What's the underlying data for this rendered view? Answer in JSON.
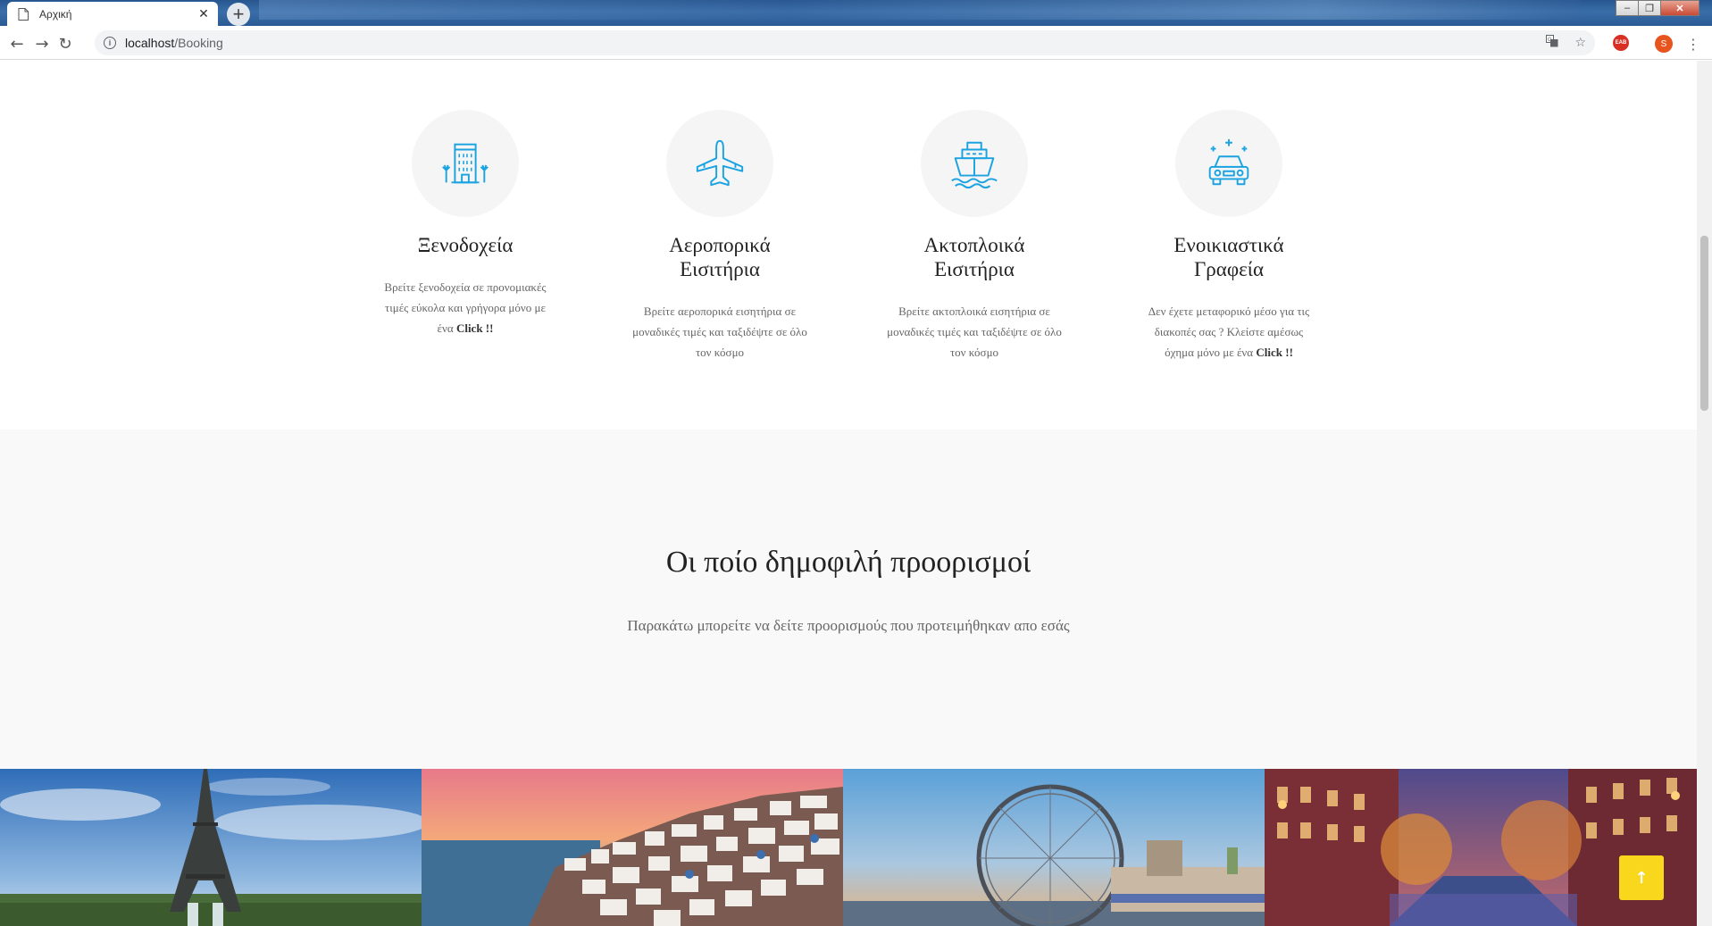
{
  "browser": {
    "tab_title": "Αρχική",
    "tab_close": "✕",
    "new_tab": "+",
    "url_host": "localhost",
    "url_path": "/Booking",
    "extension_badge": "EAB",
    "profile_initial": "S",
    "window_controls": [
      "‒",
      "❐",
      "✕"
    ]
  },
  "services": [
    {
      "icon": "hotel-icon",
      "title": "Ξενοδοχεία",
      "text_before": "Βρείτε ξενοδοχεία σε προνομιακές τιμές εύκολα και γρήγορα μόνο με ένα ",
      "text_bold": "Click !!"
    },
    {
      "icon": "airplane-icon",
      "title": "Αεροπορικά Εισιτήρια",
      "text_before": "Βρείτε αεροπορικά εισητήρια σε μοναδικές τιμές και ταξιδέψτε σε όλο τον κόσμο",
      "text_bold": ""
    },
    {
      "icon": "ship-icon",
      "title": "Ακτοπλοικά Εισιτήρια",
      "text_before": "Βρείτε ακτοπλοικά εισητήρια σε μοναδικές τιμές και ταξιδέψτε σε όλο τον κόσμο",
      "text_bold": ""
    },
    {
      "icon": "car-rental-icon",
      "title": "Ενοικιαστικά Γραφεία",
      "text_before": "Δεν έχετε μεταφορικό μέσο για τις διακοπές σας ? Κλείστε αμέσως όχημα μόνο με ένα ",
      "text_bold": "Click !!"
    }
  ],
  "popular": {
    "title": "Οι ποίο δημοφιλή προορισμοί",
    "subtitle": "Παρακάτω μπορείτε να δείτε προορισμούς που προτειμήθηκαν απο εσάς"
  },
  "gallery": [
    "paris-eiffel-tower-photo",
    "santorini-photo",
    "london-eye-photo",
    "amsterdam-canal-photo"
  ],
  "back_to_top": "↑",
  "colors": {
    "icon_blue": "#1aa3e0",
    "button_yellow": "#f9d71c"
  }
}
